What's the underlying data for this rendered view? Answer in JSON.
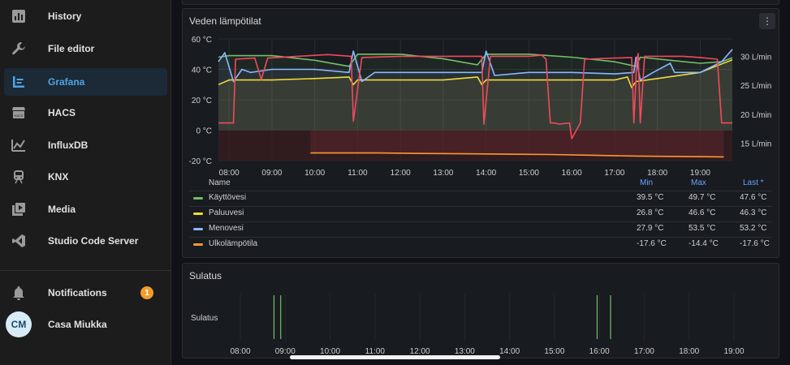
{
  "sidebar": {
    "items": [
      {
        "label": "History",
        "icon": "history-chart-icon"
      },
      {
        "label": "File editor",
        "icon": "wrench-icon"
      },
      {
        "label": "Grafana",
        "icon": "grafana-icon",
        "active": true
      },
      {
        "label": "HACS",
        "icon": "hacs-store-icon"
      },
      {
        "label": "InfluxDB",
        "icon": "influxdb-chart-icon"
      },
      {
        "label": "KNX",
        "icon": "train-icon"
      },
      {
        "label": "Media",
        "icon": "media-play-icon"
      },
      {
        "label": "Studio Code Server",
        "icon": "vscode-icon"
      }
    ],
    "notifications": {
      "label": "Notifications",
      "count": "1",
      "icon": "bell-icon"
    },
    "user": {
      "initials": "CM",
      "name": "Casa Miukka"
    }
  },
  "temp_panel": {
    "title": "Veden lämpötilat",
    "menu_icon": "more-vertical-icon",
    "legend": {
      "headers": {
        "name": "Name",
        "min": "Min",
        "max": "Max",
        "last": "Last *"
      },
      "rows": [
        {
          "name": "Käyttövesi",
          "color": "#73bf69",
          "min": "39.5 °C",
          "max": "49.7 °C",
          "last": "47.6 °C"
        },
        {
          "name": "Paluuvesi",
          "color": "#fade2a",
          "min": "26.8 °C",
          "max": "46.6 °C",
          "last": "46.3 °C"
        },
        {
          "name": "Menovesi",
          "color": "#8ab8ff",
          "min": "27.9 °C",
          "max": "53.5 °C",
          "last": "53.2 °C"
        },
        {
          "name": "Ulkolämpötila",
          "color": "#ff9830",
          "min": "-17.6 °C",
          "max": "-14.4 °C",
          "last": "-17.6 °C"
        }
      ]
    }
  },
  "sulatus_panel": {
    "title": "Sulatus",
    "row_label": "Sulatus"
  },
  "chart_data": [
    {
      "type": "line",
      "title": "Veden lämpötilat",
      "x_ticks": [
        "08:00",
        "09:00",
        "10:00",
        "11:00",
        "12:00",
        "13:00",
        "14:00",
        "15:00",
        "16:00",
        "17:00",
        "18:00",
        "19:00"
      ],
      "y_left_ticks": [
        "60 °C",
        "40 °C",
        "20 °C",
        "0 °C",
        "-20 °C"
      ],
      "y_left_range": [
        -20,
        60
      ],
      "y_right_ticks": [
        "30 L/min",
        "25 L/min",
        "20 L/min",
        "15 L/min"
      ],
      "y_right_range": [
        12,
        33
      ],
      "grid": true,
      "series": [
        {
          "name": "Käyttövesi",
          "color": "#73bf69",
          "points": [
            [
              7.75,
              48
            ],
            [
              8.0,
              49
            ],
            [
              9.0,
              49
            ],
            [
              10.0,
              46
            ],
            [
              10.8,
              42
            ],
            [
              11.0,
              50
            ],
            [
              12.0,
              50
            ],
            [
              13.0,
              47
            ],
            [
              13.8,
              43
            ],
            [
              14.0,
              50
            ],
            [
              15.0,
              50
            ],
            [
              16.0,
              48
            ],
            [
              17.0,
              45
            ],
            [
              17.5,
              42
            ],
            [
              17.6,
              48
            ],
            [
              18.3,
              46
            ],
            [
              19.0,
              44
            ],
            [
              19.5,
              45
            ],
            [
              19.75,
              47.6
            ]
          ]
        },
        {
          "name": "Paluuvesi",
          "color": "#fade2a",
          "points": [
            [
              7.75,
              30
            ],
            [
              8.0,
              33
            ],
            [
              9.0,
              33
            ],
            [
              10.0,
              34
            ],
            [
              10.8,
              35
            ],
            [
              10.9,
              30
            ],
            [
              11.0,
              33
            ],
            [
              12.0,
              33
            ],
            [
              13.0,
              33
            ],
            [
              13.8,
              35
            ],
            [
              13.9,
              30
            ],
            [
              14.0,
              33
            ],
            [
              15.0,
              33
            ],
            [
              16.0,
              33
            ],
            [
              17.0,
              33
            ],
            [
              17.3,
              35
            ],
            [
              17.4,
              28
            ],
            [
              17.5,
              32
            ],
            [
              18.0,
              34
            ],
            [
              19.0,
              38
            ],
            [
              19.75,
              46.3
            ]
          ]
        },
        {
          "name": "Menovesi",
          "color": "#8ab8ff",
          "points": [
            [
              7.75,
              45
            ],
            [
              7.9,
              51
            ],
            [
              8.1,
              32
            ],
            [
              8.3,
              40
            ],
            [
              8.5,
              38
            ],
            [
              9.0,
              40
            ],
            [
              10.0,
              40
            ],
            [
              10.8,
              38
            ],
            [
              10.9,
              52
            ],
            [
              11.1,
              32
            ],
            [
              11.4,
              38
            ],
            [
              12.0,
              38
            ],
            [
              13.0,
              38
            ],
            [
              13.9,
              38
            ],
            [
              14.0,
              52
            ],
            [
              14.2,
              36
            ],
            [
              15.0,
              38
            ],
            [
              16.0,
              38
            ],
            [
              17.0,
              37
            ],
            [
              17.45,
              38
            ],
            [
              17.5,
              48
            ],
            [
              17.6,
              33
            ],
            [
              17.9,
              38
            ],
            [
              18.3,
              44
            ],
            [
              18.4,
              38
            ],
            [
              19.0,
              38
            ],
            [
              19.5,
              45
            ],
            [
              19.75,
              53.2
            ]
          ]
        },
        {
          "name": "Ulkolämpötila",
          "color": "#ff9830",
          "points": [
            [
              9.9,
              -15
            ],
            [
              10.5,
              -15
            ],
            [
              11.5,
              -15
            ],
            [
              12.5,
              -15.3
            ],
            [
              13.5,
              -15.5
            ],
            [
              14.5,
              -15.8
            ],
            [
              15.5,
              -16
            ],
            [
              16.5,
              -16.5
            ],
            [
              17.5,
              -17
            ],
            [
              18.5,
              -17.3
            ],
            [
              19.55,
              -17.6
            ]
          ]
        },
        {
          "name": "",
          "color": "#f2495c",
          "axis": "right",
          "points": [
            [
              7.75,
              18.5
            ],
            [
              8.1,
              18.5
            ],
            [
              8.15,
              29.5
            ],
            [
              8.6,
              29.7
            ],
            [
              8.75,
              26
            ],
            [
              8.9,
              29.7
            ],
            [
              9.6,
              30
            ],
            [
              10.3,
              30.3
            ],
            [
              10.85,
              30
            ],
            [
              10.9,
              18.8
            ],
            [
              11.1,
              29.8
            ],
            [
              12.0,
              30
            ],
            [
              13.0,
              30
            ],
            [
              13.9,
              30
            ],
            [
              13.95,
              18.3
            ],
            [
              14.1,
              30
            ],
            [
              15.0,
              30
            ],
            [
              15.3,
              30.2
            ],
            [
              15.4,
              29.5
            ],
            [
              15.5,
              18.5
            ],
            [
              15.6,
              18.5
            ],
            [
              15.7,
              18.3
            ],
            [
              15.95,
              18.5
            ],
            [
              16.0,
              15.8
            ],
            [
              16.2,
              18.5
            ],
            [
              16.3,
              29.5
            ],
            [
              17.0,
              29.7
            ],
            [
              17.4,
              29.8
            ],
            [
              17.45,
              18.5
            ],
            [
              17.52,
              29.5
            ],
            [
              17.55,
              30.5
            ],
            [
              17.6,
              18.5
            ],
            [
              17.7,
              30
            ],
            [
              18.0,
              30
            ],
            [
              18.6,
              30
            ],
            [
              19.0,
              29.8
            ],
            [
              19.4,
              29.5
            ],
            [
              19.5,
              18.5
            ],
            [
              19.75,
              18.5
            ]
          ]
        }
      ]
    },
    {
      "type": "state-timeline",
      "title": "Sulatus",
      "x_ticks": [
        "08:00",
        "09:00",
        "10:00",
        "11:00",
        "12:00",
        "13:00",
        "14:00",
        "15:00",
        "16:00",
        "17:00",
        "18:00",
        "19:00"
      ],
      "events_at_hour": [
        8.75,
        8.9,
        15.95,
        16.25
      ],
      "event_color": "#73bf69"
    }
  ]
}
